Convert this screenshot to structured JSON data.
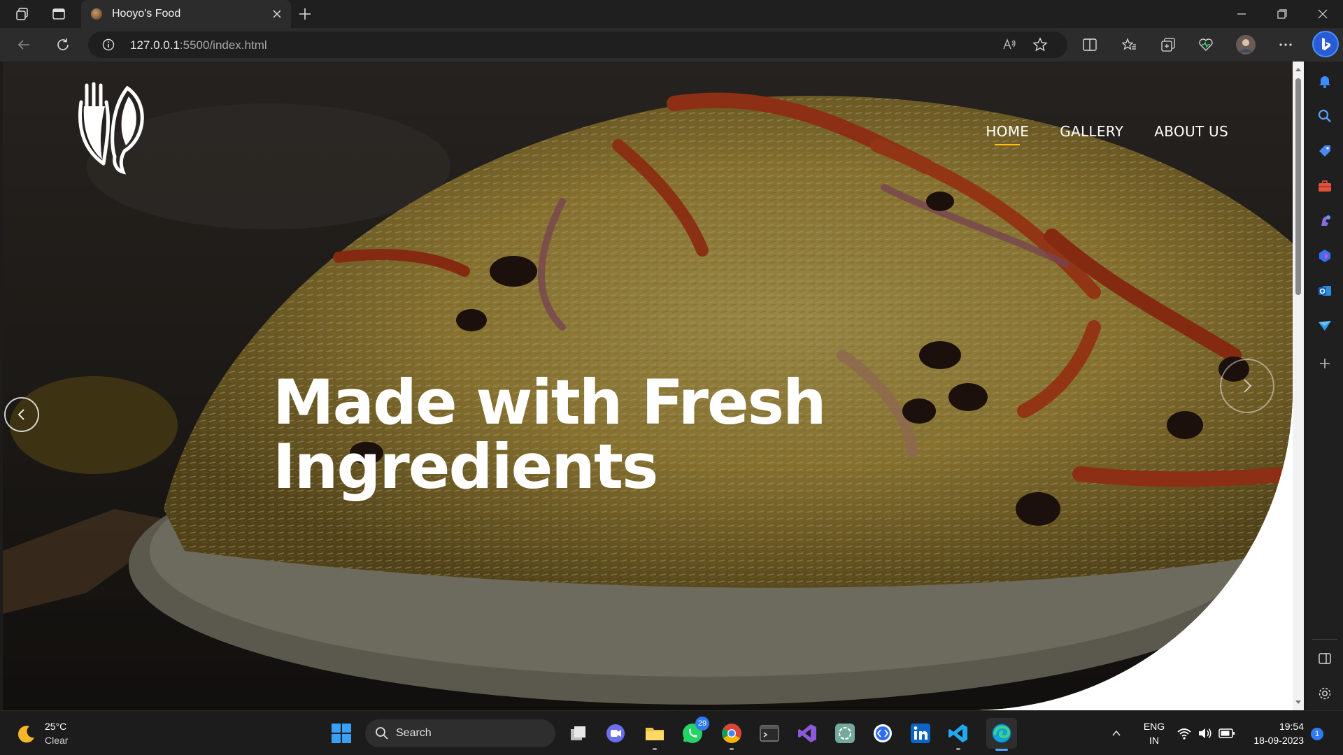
{
  "browser": {
    "tab_title": "Hooyo's Food",
    "url_host": "127.0.0.1",
    "url_path": ":5500/index.html"
  },
  "site": {
    "nav": [
      {
        "label": "HOME",
        "active": true
      },
      {
        "label": "GALLERY",
        "active": false
      },
      {
        "label": "ABOUT US",
        "active": false
      }
    ],
    "headline_line1": "Made with Fresh",
    "headline_line2": "Ingredients",
    "accent": "#ffc107"
  },
  "taskbar": {
    "weather_temp": "25°C",
    "weather_condition": "Clear",
    "search_label": "Search",
    "whatsapp_badge": "29",
    "lang_top": "ENG",
    "lang_bottom": "IN",
    "time": "19:54",
    "date": "18-09-2023",
    "notification_count": "1"
  }
}
